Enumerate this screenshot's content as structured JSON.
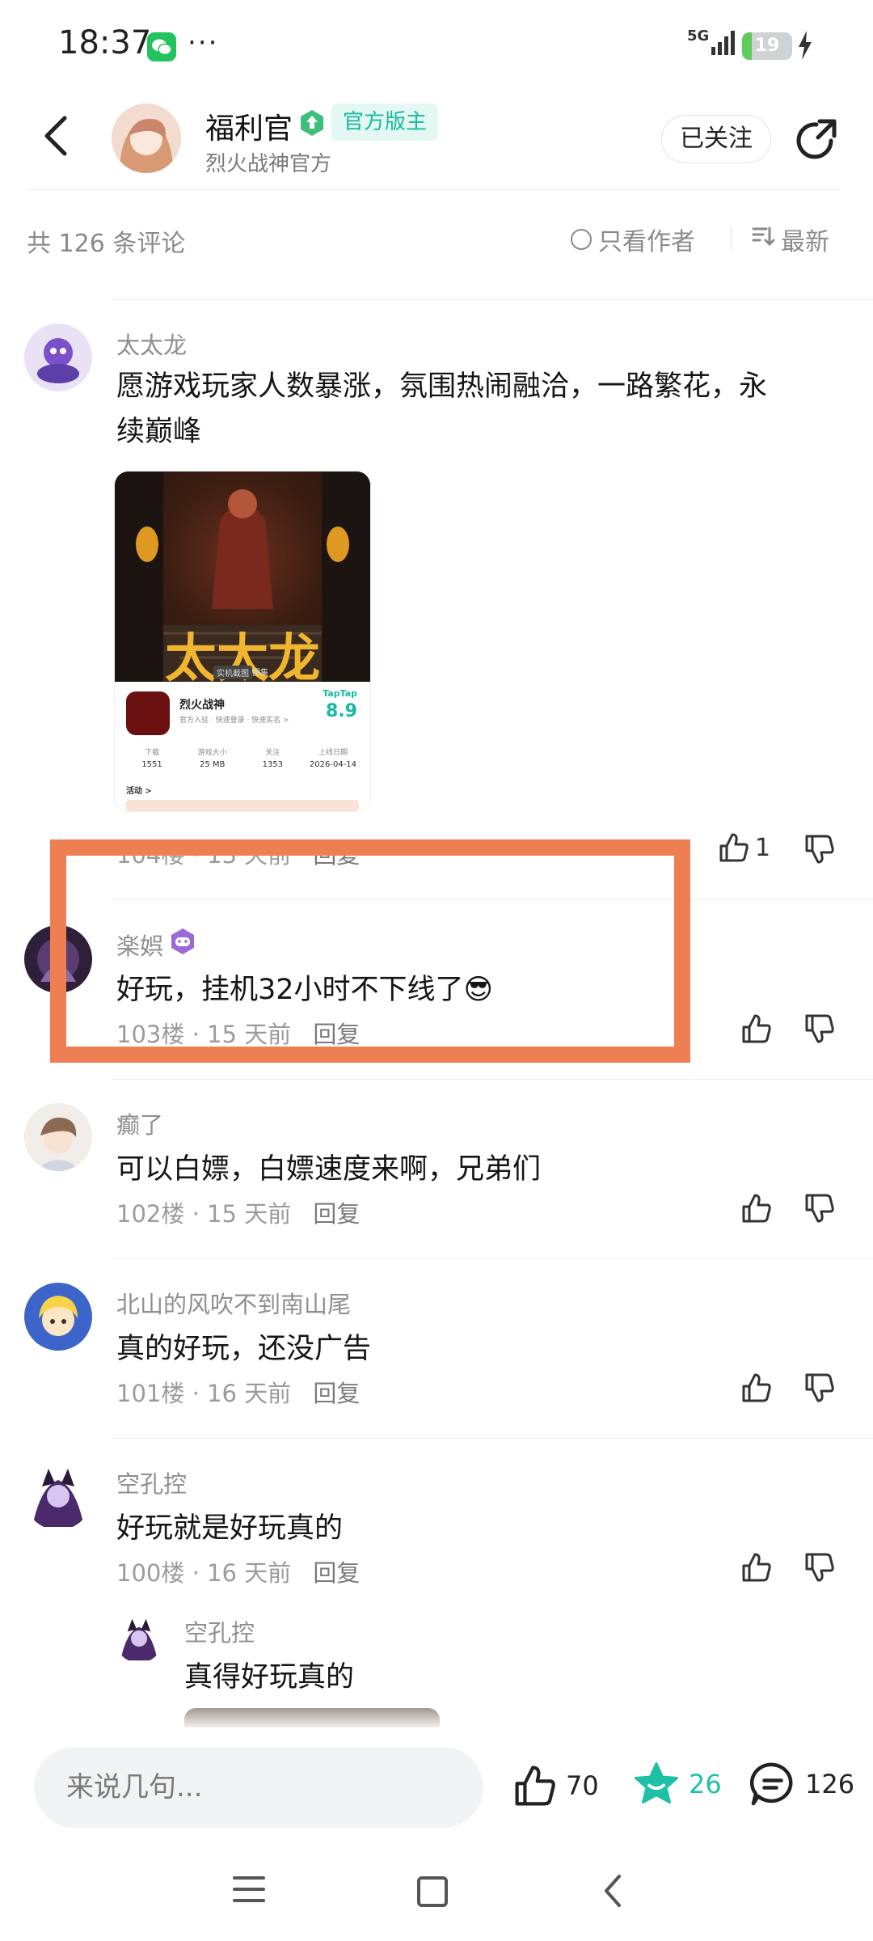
{
  "status_bar": {
    "time": "18:37",
    "more": "···",
    "network": "5G",
    "battery": "19",
    "battery_level": 0.19
  },
  "header": {
    "author_name": "福利官",
    "badge": "官方版主",
    "subtitle": "烈火战神官方",
    "follow_label": "已关注"
  },
  "comments_bar": {
    "count_text": "共 126 条评论",
    "author_only_label": "只看作者",
    "sort_label": "最新"
  },
  "embedded_card": {
    "art_title": "太太龙",
    "tag1": "实机截图",
    "tag2": "图集",
    "game_name": "烈火战神",
    "game_sub": "官方入驻 · 快速登录 · 快速实名 >",
    "platform": "TapTap",
    "score": "8.9",
    "stats": [
      {
        "label": "下载",
        "value": "1551"
      },
      {
        "label": "游戏大小",
        "value": "25 MB"
      },
      {
        "label": "关注",
        "value": "1353"
      },
      {
        "label": "上线日期",
        "value": "2026-04-14"
      }
    ],
    "activity_label": "活动 >"
  },
  "comments": [
    {
      "name": "太太龙",
      "text_line1": " 愿游戏玩家人数暴涨，氛围热闹融洽，一路繁花，永",
      "text_line2": "续巅峰",
      "meta": "104楼 · 13 天前",
      "reply": "回复",
      "likes": "1"
    },
    {
      "name": "楽娯",
      "text": "好玩，挂机32小时不下线了😎",
      "meta": "103楼 · 15 天前",
      "reply": "回复"
    },
    {
      "name": "癫了",
      "text": "可以白嫖，白嫖速度来啊，兄弟们",
      "meta": "102楼 · 15 天前",
      "reply": "回复"
    },
    {
      "name": "北山的风吹不到南山尾",
      "text": "真的好玩，还没广告",
      "meta": "101楼 · 16 天前",
      "reply": "回复"
    },
    {
      "name": "空孔控",
      "text": "好玩就是好玩真的",
      "meta": "100楼 · 16 天前",
      "reply": "回复"
    }
  ],
  "sub_reply": {
    "name": "空孔控",
    "text": "真得好玩真的"
  },
  "bottom_bar": {
    "input_placeholder": "来说几句...",
    "likes": "70",
    "stars": "26",
    "comments": "126"
  },
  "colors": {
    "accent": "#18b9a1",
    "highlight": "#ee7f52"
  }
}
